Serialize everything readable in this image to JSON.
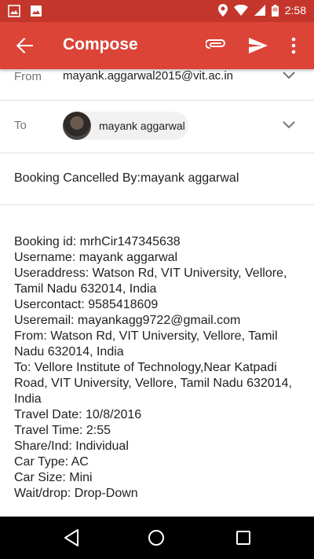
{
  "status_bar": {
    "time": "2:58"
  },
  "app_bar": {
    "title": "Compose"
  },
  "from": {
    "label": "From",
    "value": "mayank.aggarwal2015@vit.ac.in"
  },
  "to": {
    "label": "To",
    "recipient_name": "mayank aggarwal"
  },
  "subject": "Booking Cancelled By:mayank aggarwal",
  "body_lines": [
    "Booking id: mrhCir147345638",
    "Username: mayank aggarwal",
    "Useraddress: Watson Rd, VIT University, Vellore, Tamil Nadu 632014, India",
    "Usercontact: 9585418609",
    "Useremail: mayankagg9722@gmail.com",
    "From: Watson Rd, VIT University, Vellore, Tamil Nadu 632014, India",
    "To: Vellore Institute of Technology,Near Katpadi Road, VIT University, Vellore, Tamil Nadu 632014, India",
    "Travel Date: 10/8/2016",
    "Travel Time: 2:55",
    "Share/Ind: Individual",
    "Car Type: AC",
    "Car Size: Mini",
    "Wait/drop: Drop-Down"
  ],
  "colors": {
    "app_bar": "#db4437",
    "status_bar": "#c4362b"
  },
  "icons": [
    "image-icon",
    "photo-icon",
    "location-icon",
    "wifi-icon",
    "signal-icon",
    "battery-icon",
    "back-arrow-icon",
    "attach-icon",
    "send-icon",
    "more-vert-icon",
    "chevron-down-icon",
    "nav-back-icon",
    "nav-home-icon",
    "nav-recents-icon"
  ]
}
